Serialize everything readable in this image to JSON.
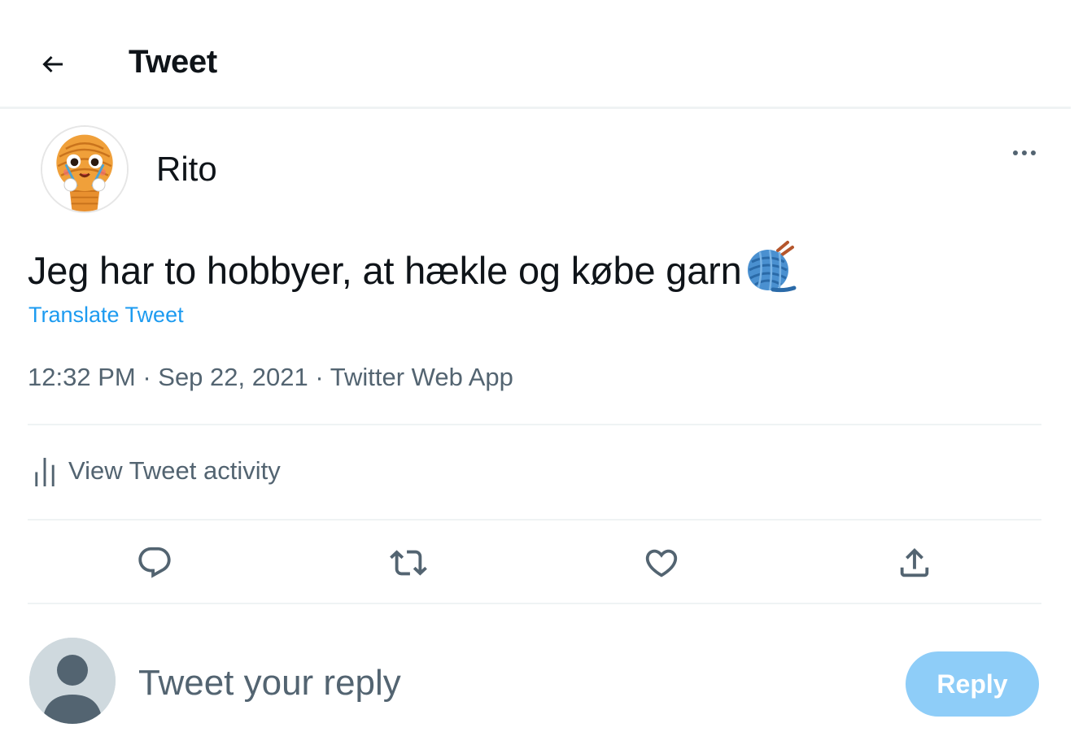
{
  "header": {
    "title": "Tweet",
    "back_icon": "arrow-left-icon"
  },
  "tweet": {
    "author_name": "Rito",
    "text": "Jeg har to hobbyer, at hækle og købe garn",
    "emoji": "yarn-emoji",
    "translate_label": "Translate Tweet",
    "time": "12:32 PM",
    "date": "Sep 22, 2021",
    "source": "Twitter Web App",
    "view_activity_label": "View Tweet activity"
  },
  "actions": [
    {
      "name": "reply",
      "icon": "comment-icon"
    },
    {
      "name": "retweet",
      "icon": "retweet-icon"
    },
    {
      "name": "like",
      "icon": "heart-icon"
    },
    {
      "name": "share",
      "icon": "share-icon"
    }
  ],
  "composer": {
    "placeholder": "Tweet your reply",
    "reply_button_label": "Reply"
  },
  "colors": {
    "text": "#0f1419",
    "secondary": "#536471",
    "accent": "#1d9bf0",
    "reply_button_disabled": "#8ecdf8",
    "divider": "#eff3f4"
  }
}
